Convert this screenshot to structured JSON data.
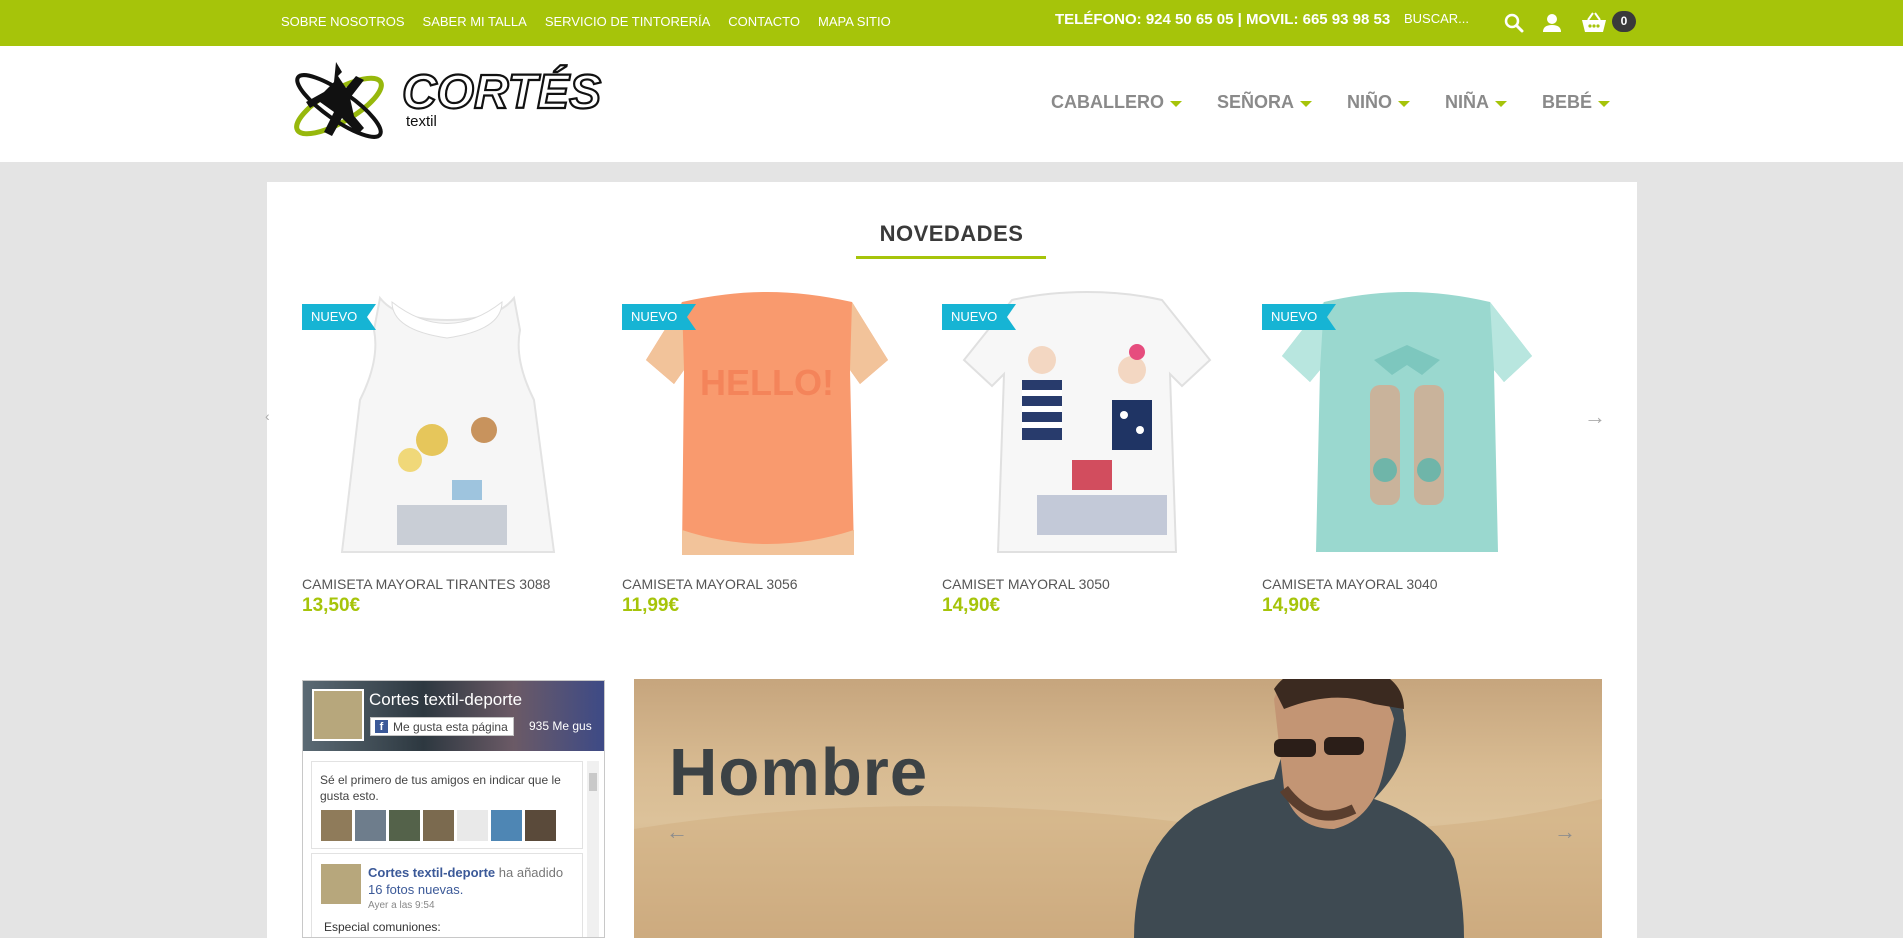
{
  "topbar": {
    "links": [
      "SOBRE NOSOTROS",
      "SABER MI TALLA",
      "SERVICIO DE TINTORERÍA",
      "CONTACTO",
      "MAPA SITIO"
    ],
    "phone": "TELÉFONO: 924 50 65 05 | MOVIL: 665 93 98 53",
    "search_placeholder": "BUSCAR...",
    "cart_count": "0",
    "icons": [
      "search-icon",
      "user-icon",
      "basket-icon"
    ]
  },
  "logo": {
    "text": "CORTÉS",
    "sub": "textil"
  },
  "nav": {
    "items": [
      "CABALLERO",
      "SEÑORA",
      "NIÑO",
      "NIÑA",
      "BEBÉ"
    ]
  },
  "novedades": {
    "title": "NOVEDADES",
    "products": [
      {
        "badge": "NUEVO",
        "name": "CAMISETA MAYORAL TIRANTES 3088",
        "price": "13,50€",
        "color": "#f7f7f7"
      },
      {
        "badge": "NUEVO",
        "name": "CAMISETA MAYORAL 3056",
        "price": "11,99€",
        "color": "#f8956a"
      },
      {
        "badge": "NUEVO",
        "name": "CAMISET MAYORAL 3050",
        "price": "14,90€",
        "color": "#f7f7f7"
      },
      {
        "badge": "NUEVO",
        "name": "CAMISETA MAYORAL 3040",
        "price": "14,90€",
        "color": "#9ad8cf"
      }
    ]
  },
  "facebook": {
    "page_name": "Cortes textil-deporte",
    "like_button": "Me gusta esta página",
    "like_count": "935 Me gus",
    "friends_text": "Sé el primero de tus amigos en indicar que le gusta esto.",
    "post_author": "Cortes textil-deporte",
    "post_action": "ha añadido",
    "post_link": "16 fotos nuevas.",
    "post_time": "Ayer a las 9:54",
    "post_text": "Especial comuniones:"
  },
  "banner": {
    "title": "Hombre"
  },
  "colors": {
    "accent": "#a6c40a",
    "badge": "#16b4d4",
    "dark": "#3a3a3a"
  }
}
